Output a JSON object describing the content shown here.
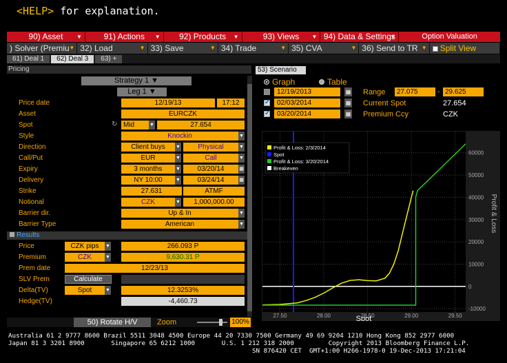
{
  "help": {
    "key": "<HELP>",
    "text": " for explanation."
  },
  "menu1": [
    {
      "label": "90) Asset"
    },
    {
      "label": "91) Actions"
    },
    {
      "label": "92) Products"
    },
    {
      "label": "93) Views"
    },
    {
      "label": "94) Data & Settings"
    },
    {
      "label": "Option Valuation"
    }
  ],
  "menu2": [
    {
      "label": ") Solver (Premiu"
    },
    {
      "label": "32) Load"
    },
    {
      "label": "33) Save"
    },
    {
      "label": "34) Trade"
    },
    {
      "label": "35) CVA"
    },
    {
      "label": "36) Send to TR"
    },
    {
      "label": "Split View"
    }
  ],
  "tabs": [
    "61) Deal 1",
    "62) Deal 3",
    "63) +"
  ],
  "pricing": {
    "title": "Pricing",
    "strategy": "Strategy 1",
    "leg": "Leg 1",
    "labels": {
      "price_date": "Price date",
      "asset": "Asset",
      "spot": "Spot",
      "style": "Style",
      "direction": "Direction",
      "callput": "Call/Put",
      "expiry": "Expiry",
      "delivery": "Delivery",
      "strike": "Strike",
      "notional": "Notional",
      "barrier_dir": "Barrier dir.",
      "barrier_type": "Barrier Type"
    },
    "price_date": "12/19/13",
    "price_time": "17:12",
    "asset": "EURCZK",
    "spot_side": "Mid",
    "spot": "27.654",
    "style": "Knockin",
    "direction": "Client buys",
    "direction2": "Physical",
    "ccy": "EUR",
    "callput": "Call",
    "expiry_tenor": "3 months",
    "expiry_date": "03/20/14",
    "delivery_time": "NY 10:00",
    "delivery_date": "03/24/14",
    "strike": "27.631",
    "strike_type": "ATMF",
    "notional_ccy": "CZK",
    "notional": "1,000,000.00",
    "barrier_dir": "Up & In",
    "barrier_type": "American"
  },
  "results": {
    "header": "Results",
    "labels": {
      "price": "Price",
      "premium": "Premium",
      "prem_date": "Prem date",
      "slv_prem": "SLV Prem",
      "delta": "Delta(TV)",
      "hedge": "Hedge(TV)"
    },
    "price_unit": "CZK pips",
    "price": "266.093 P",
    "premium_ccy": "CZK",
    "premium": "9,630.31 P",
    "prem_date": "12/23/13",
    "calculate": "Calculate",
    "delta_type": "Spot",
    "delta": "12.3253%",
    "hedge": "-4,460.73"
  },
  "bottom": {
    "rotate": "50) Rotate H/V",
    "zoom_label": "Zoom",
    "zoom": "100%"
  },
  "scenario": {
    "tab": "53) Scenario",
    "graph": "Graph",
    "table": "Table",
    "dates": [
      "12/19/2013",
      "02/03/2014",
      "03/20/2014"
    ],
    "checked": [
      false,
      true,
      true
    ],
    "range_label": "Range",
    "range_from": "27.075",
    "range_dash": "-",
    "range_to": "29.625",
    "current_spot_label": "Current Spot",
    "current_spot": "27.654",
    "premium_ccy_label": "Premium Ccy",
    "premium_ccy": "CZK"
  },
  "chart_data": {
    "type": "line",
    "title": "",
    "xlabel": "Spot",
    "ylabel": "Profit & Loss",
    "xlim": [
      27.3,
      29.62
    ],
    "ylim": [
      -11500,
      69500
    ],
    "xticks": [
      27.5,
      28.0,
      28.5,
      29.0,
      29.5
    ],
    "xtick_labels": [
      "27.50",
      "28.00",
      "28.50",
      "29.00",
      "29.50"
    ],
    "yticks": [
      -10000,
      0,
      10000,
      20000,
      30000,
      40000,
      50000,
      60000
    ],
    "ytick_labels": [
      "-10000",
      "0",
      "10000",
      "20000",
      "30000",
      "40000",
      "50000",
      "60000"
    ],
    "legend": [
      "Profit & Loss: 2/3/2014",
      "Spot",
      "Profit & Loss: 3/20/2014",
      "Breakeven"
    ],
    "legend_position": "top-left",
    "colors": {
      "pl1": "#f0f000",
      "spot": "#1a1aff",
      "pl2": "#22cc22",
      "breakeven": "#ffffff"
    },
    "spot_value": 27.654,
    "breakeven_value": 0,
    "series": [
      {
        "name": "Profit & Loss: 2/3/2014",
        "x": [
          27.3,
          27.5,
          27.7,
          27.8,
          27.9,
          28.0,
          28.1,
          28.2,
          28.3,
          28.4,
          28.5,
          28.6,
          28.7,
          28.75,
          28.8,
          28.85,
          28.9,
          28.95,
          29.0,
          29.02
        ],
        "y": [
          -8300,
          -8100,
          -7400,
          -6300,
          -4900,
          -3000,
          -700,
          1400,
          2700,
          3000,
          2600,
          2500,
          3700,
          6000,
          10000,
          16000,
          24000,
          32000,
          40000,
          43000
        ]
      },
      {
        "name": "Profit & Loss: 3/20/2014",
        "x": [
          27.3,
          29.05,
          29.05,
          29.07,
          29.62
        ],
        "y": [
          -8400,
          -8400,
          40000,
          43000,
          64000
        ]
      }
    ]
  },
  "footer": {
    "line1": "Australia 61 2 9777 8600 Brazil 5511 3048 4500 Europe 44 20 7330 7500 Germany 49 69 9204 1210 Hong Kong 852 2977 6000",
    "line2": "Japan 81 3 3201 8900       Singapore 65 6212 1000       U.S. 1 212 318 2000         Copyright 2013 Bloomberg Finance L.P.",
    "line3": "                                                                SN 876420 CET  GMT+1:00 H266-1978-0 19-Dec-2013 17:21:04"
  }
}
